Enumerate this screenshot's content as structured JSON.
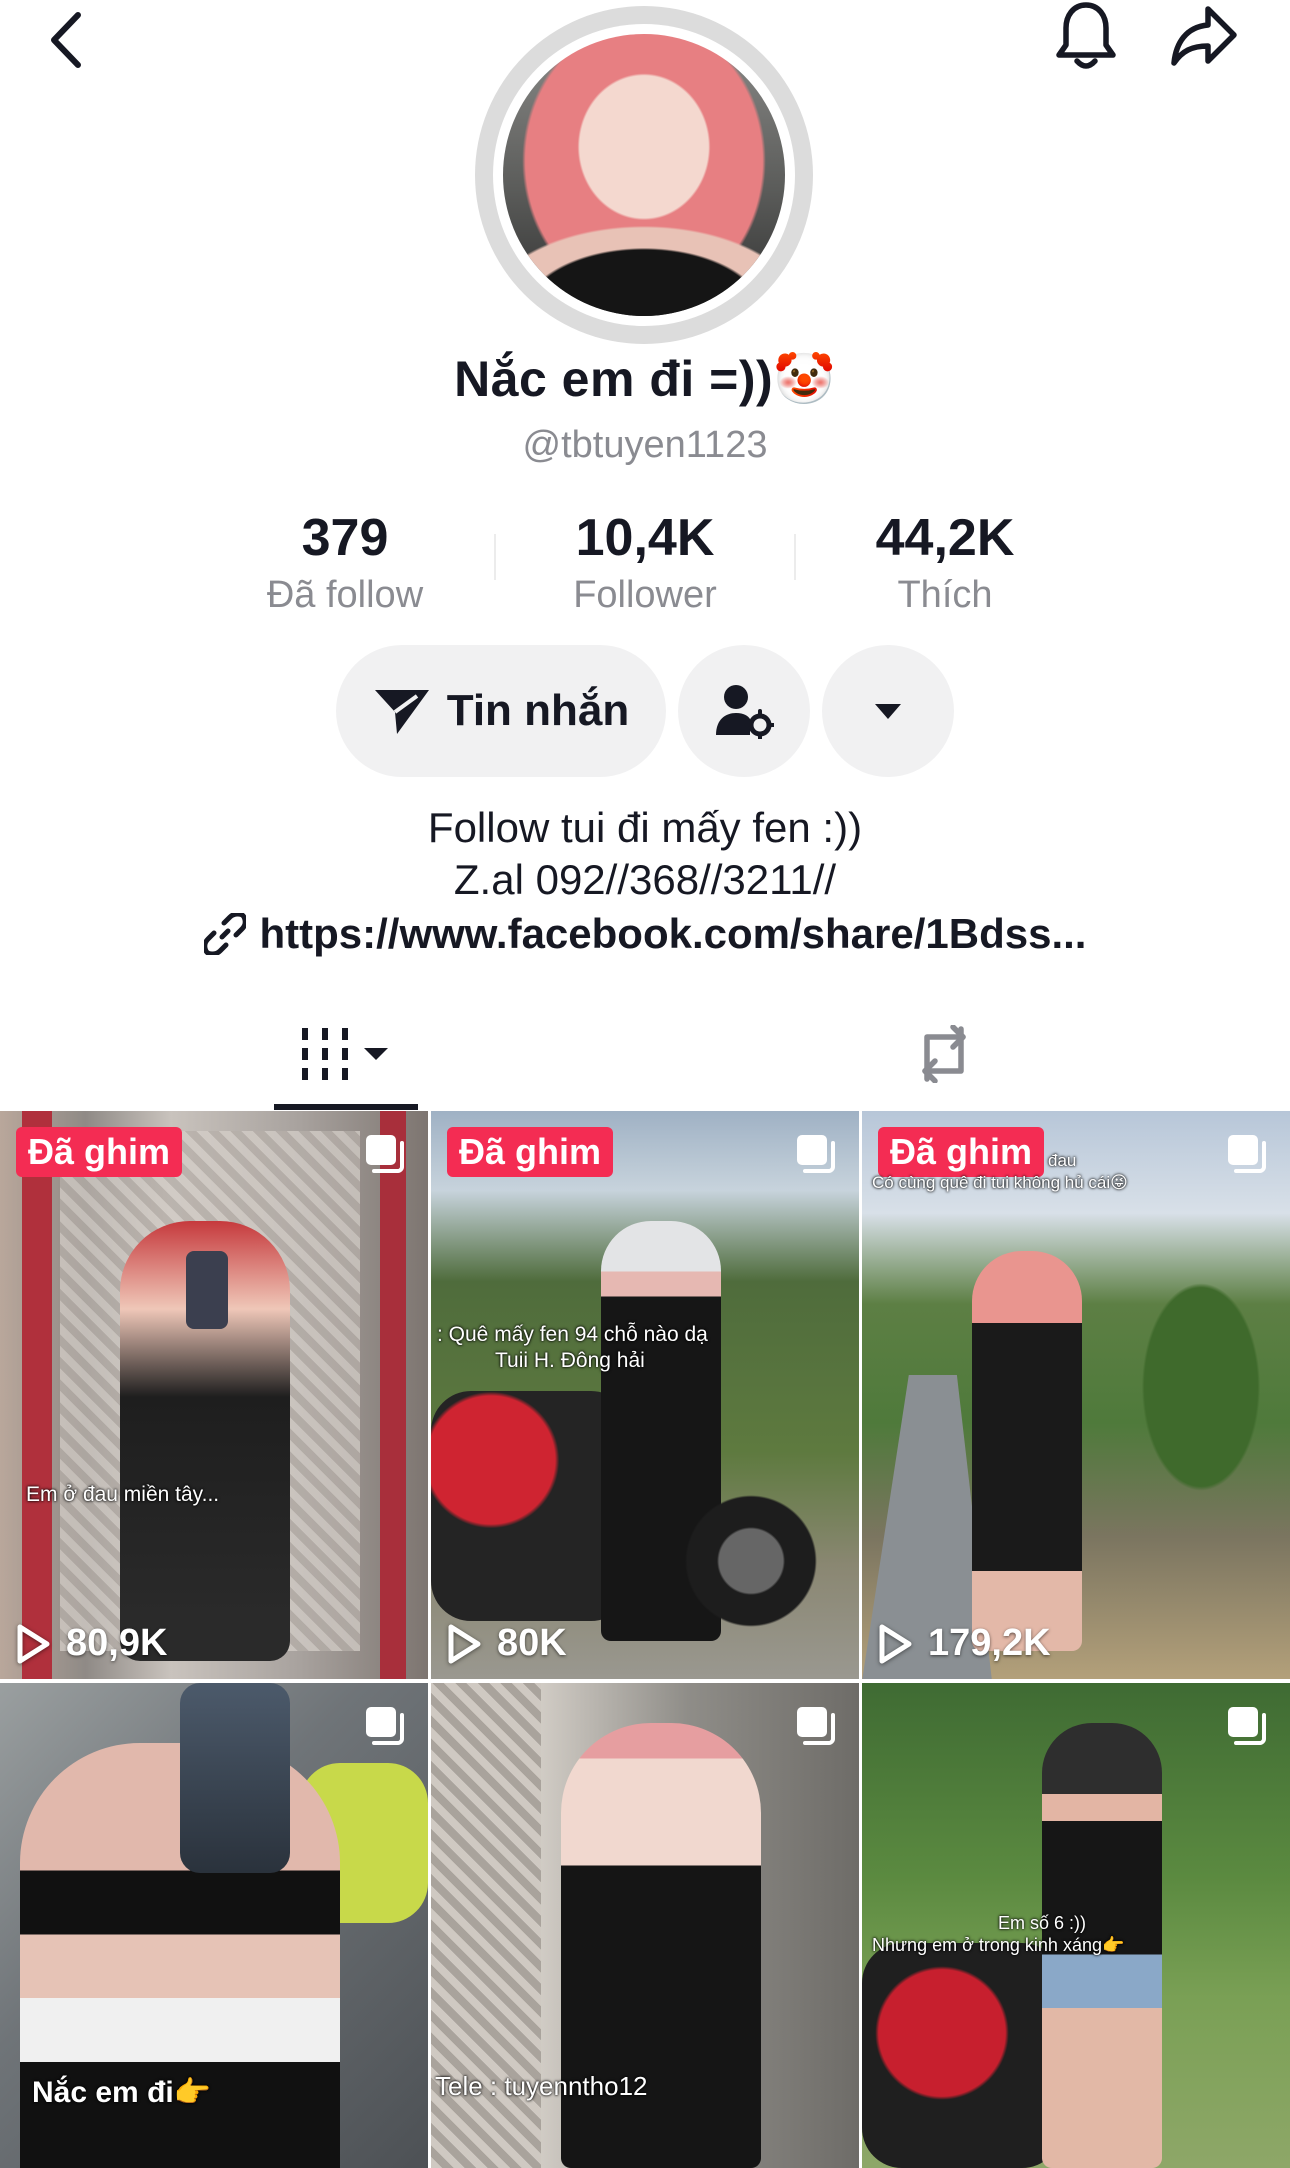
{
  "header": {
    "back_icon": "chevron-left-icon",
    "bell_icon": "bell-icon",
    "share_icon": "share-arrow-icon"
  },
  "profile": {
    "display_name": "Nắc em đi =))🤡",
    "username": "@tbtuyen1123"
  },
  "stats": [
    {
      "value": "379",
      "label": "Đã follow"
    },
    {
      "value": "10,4K",
      "label": "Follower"
    },
    {
      "value": "44,2K",
      "label": "Thích"
    }
  ],
  "actions": {
    "message_label": "Tin nhắn",
    "message_icon": "send-icon",
    "follow_settings_icon": "user-gear-icon",
    "more_icon": "caret-down-icon"
  },
  "bio": {
    "line1": "Follow tui đi mấy fen :))",
    "line2": "Z.al 092//368//3211//",
    "link_text": "https://www.facebook.com/share/1Bdss...",
    "link_icon": "link-icon"
  },
  "tabs": {
    "videos_icon": "grid-icon",
    "reposts_icon": "repost-icon"
  },
  "videos": [
    {
      "pinned_label": "Đã ghim",
      "views": "80,9K",
      "caption": "Em ở đau miền tây..."
    },
    {
      "pinned_label": "Đã ghim",
      "views": "80K",
      "caption_line1": ": Quê mấy fen 94 chỗ nào dạ",
      "caption_line2": "Tuii H. Đông hải"
    },
    {
      "pinned_label": "Đã ghim",
      "views": "179,2K",
      "caption_line1": "đau",
      "caption_line2": "Có cùng quê đi tui không hủ cái😜"
    },
    {
      "caption": "Nắc em đi👉"
    },
    {
      "caption": "Tele : tuyenntho12"
    },
    {
      "caption_line1": "Em số 6 :))",
      "caption_line2": "Nhưng em ở trong kinh xáng👉"
    }
  ],
  "colors": {
    "pin_badge": "#f42c53",
    "secondary_text": "#8a8b91",
    "button_bg": "#f1f1f2"
  }
}
